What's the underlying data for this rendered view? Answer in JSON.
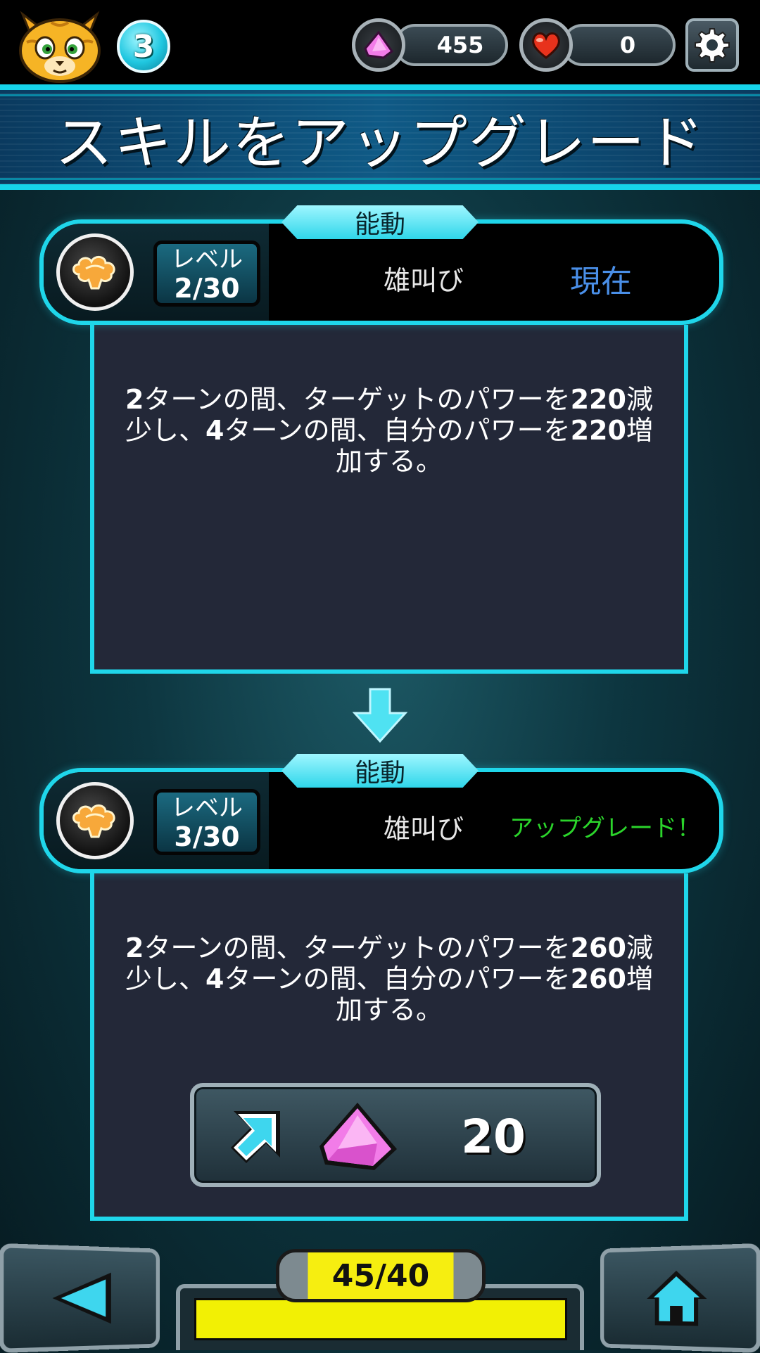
{
  "player": {
    "level": "3"
  },
  "currency": {
    "gems": "455",
    "hearts": "0"
  },
  "title": "スキルをアップグレード",
  "current_skill": {
    "type": "能動",
    "level_label": "レベル",
    "level": "2/30",
    "name": "雄叫び",
    "status": "現在",
    "desc_parts": [
      "2",
      "ターンの間、ターゲットのパワーを",
      "220",
      "減少し、",
      "4",
      "ターンの間、自分のパワーを",
      "220",
      "増加する。"
    ]
  },
  "next_skill": {
    "type": "能動",
    "level_label": "レベル",
    "level": "3/30",
    "name": "雄叫び",
    "status": "アップグレード！",
    "desc_parts": [
      "2",
      "ターンの間、ターゲットのパワーを",
      "260",
      "減少し、",
      "4",
      "ターンの間、自分のパワーを",
      "260",
      "増加する。"
    ]
  },
  "upgrade": {
    "cost": "20"
  },
  "energy": {
    "label": "45/40",
    "fill_fraction": 1.0
  },
  "colors": {
    "accent": "#1fd6ea",
    "status_current": "#4a8fe8",
    "status_upgrade": "#2bd42b",
    "energy_fill": "#f2f004"
  },
  "icons": {
    "avatar": "cat-face-icon",
    "gem": "pink-gem-icon",
    "heart": "heart-icon",
    "settings": "gear-icon",
    "skill": "roar-cloud-icon",
    "upgrade": "upgrade-arrow-icon",
    "back": "back-triangle-icon",
    "home": "home-icon"
  }
}
